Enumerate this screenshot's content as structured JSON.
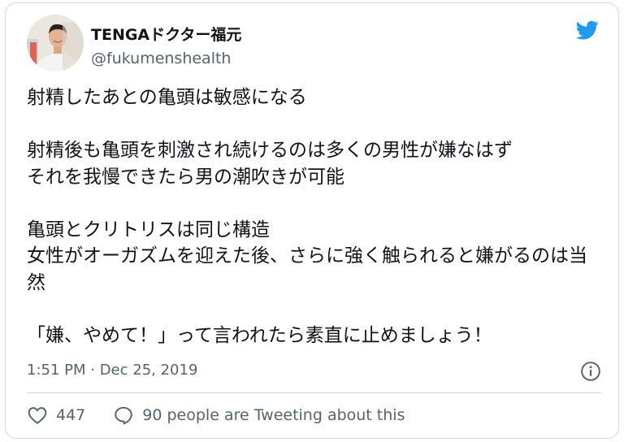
{
  "tweet": {
    "author": {
      "display_name": "TENGAドクター福元",
      "handle": "@fukumenshealth"
    },
    "text": "射精したあとの亀頭は敏感になる\n\n射精後も亀頭を刺激され続けるのは多くの男性が嫌なはず\nそれを我慢できたら男の潮吹きが可能\n\n亀頭とクリトリスは同じ構造\n女性がオーガズムを迎えた後、さらに強く触られると嫌がるのは当然\n\n「嫌、やめて！」って言われたら素直に止めましょう！",
    "timestamp": "1:51 PM · Dec 25, 2019",
    "likes": "447",
    "reply_label": "90 people are Tweeting about this"
  },
  "icons": {
    "brand": "twitter-bird-icon",
    "info": "info-icon",
    "like": "heart-icon",
    "reply": "speech-bubble-icon"
  },
  "colors": {
    "twitter_blue": "#1d9bf0",
    "secondary_text": "#536471",
    "border": "#cfd9de"
  }
}
